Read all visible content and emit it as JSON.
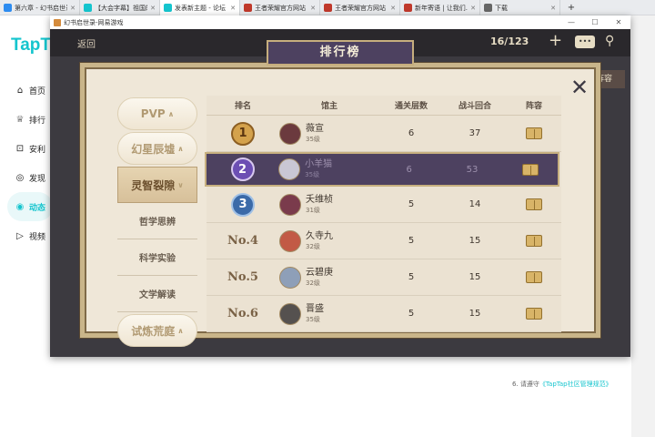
{
  "browser": {
    "tabs": [
      {
        "label": "第六章 - 幻书启世录",
        "color": "#2d8cf0"
      },
      {
        "label": "【大会字幕】祖国的...",
        "color": "#15c5ce"
      },
      {
        "label": "发表新主题 - 论坛",
        "color": "#15c5ce",
        "active": true
      },
      {
        "label": "王者荣耀官方网站",
        "color": "#c0392b"
      },
      {
        "label": "王者荣耀官方网站",
        "color": "#c0392b"
      },
      {
        "label": "新年寄语 | 让我们...",
        "color": "#c0392b"
      },
      {
        "label": "下载",
        "color": "#666"
      }
    ],
    "new_tab": "+"
  },
  "site": {
    "logo": "TapTap",
    "sidebar": [
      {
        "icon": "⌂",
        "label": "首页"
      },
      {
        "icon": "♕",
        "label": "排行"
      },
      {
        "icon": "⊡",
        "label": "安利"
      },
      {
        "icon": "◎",
        "label": "发现"
      },
      {
        "icon": "◉",
        "label": "动态",
        "active": true
      },
      {
        "icon": "▷",
        "label": "视频"
      }
    ],
    "rules_prefix": "6. 请遵守",
    "rules_link": "《TapTap社区管理规范》"
  },
  "game_window": {
    "title": "幻书启世录-网易游戏",
    "min": "—",
    "max": "☐",
    "close": "✕",
    "topbar": {
      "back": "返回",
      "count": "16/123",
      "plus": "+",
      "chat": "•••",
      "pin": "⚲"
    },
    "right_tab": "阵容",
    "panel": {
      "title": "排行榜",
      "close": "✕",
      "categories": [
        {
          "label": "PVP",
          "style": "pill"
        },
        {
          "label": "幻星辰墟",
          "style": "pill"
        },
        {
          "label": "灵智裂隙",
          "style": "sel"
        },
        {
          "label": "哲学思辨",
          "style": "plain"
        },
        {
          "label": "科学实验",
          "style": "plain"
        },
        {
          "label": "文学解读",
          "style": "plain"
        },
        {
          "label": "试炼荒庭",
          "style": "pill"
        }
      ],
      "headers": {
        "rank": "排名",
        "host": "馆主",
        "floors": "通关层数",
        "rounds": "战斗回合",
        "lineup": "阵容"
      },
      "rows": [
        {
          "rank": "1",
          "badge": "rb1",
          "name": "薇宣",
          "level": "35级",
          "floors": "6",
          "rounds": "37",
          "avatar": "#6b3a3e"
        },
        {
          "rank": "2",
          "badge": "rb2",
          "name": "小羊猫",
          "level": "35级",
          "floors": "6",
          "rounds": "53",
          "avatar": "#c9c7d4",
          "highlight": true
        },
        {
          "rank": "3",
          "badge": "rb3",
          "name": "夭维桢",
          "level": "31级",
          "floors": "5",
          "rounds": "14",
          "avatar": "#7a3b4c"
        },
        {
          "rank": "No.4",
          "name": "久寺九",
          "level": "32级",
          "floors": "5",
          "rounds": "15",
          "avatar": "#c25a45"
        },
        {
          "rank": "No.5",
          "name": "云碧庚",
          "level": "32级",
          "floors": "5",
          "rounds": "15",
          "avatar": "#8e9fb8"
        },
        {
          "rank": "No.6",
          "name": "晋盛",
          "level": "35级",
          "floors": "5",
          "rounds": "15",
          "avatar": "#55514f"
        }
      ]
    }
  }
}
